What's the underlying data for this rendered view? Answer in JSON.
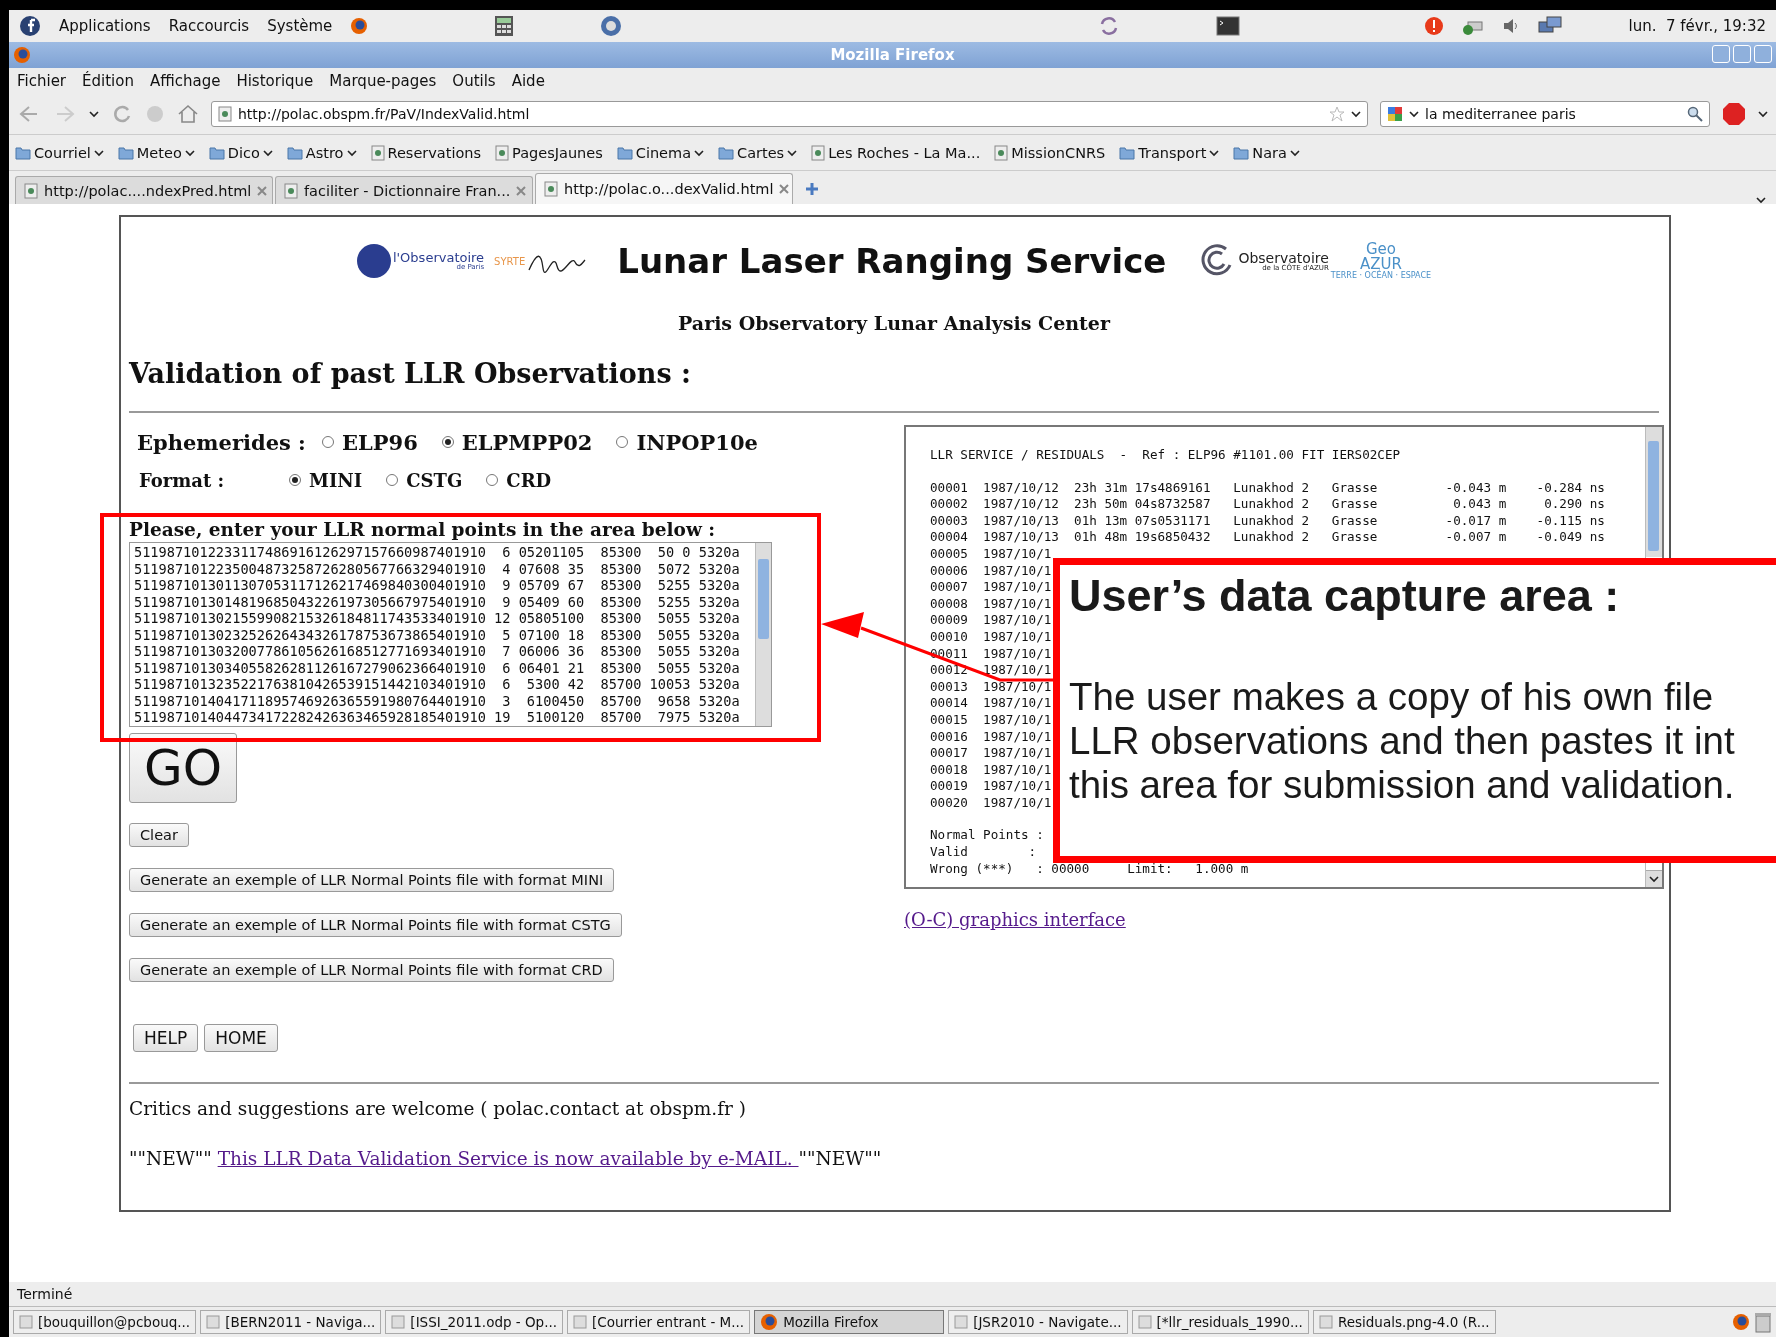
{
  "top_panel": {
    "menus": [
      "Applications",
      "Raccourcis",
      "Système"
    ],
    "clock": "lun.  7 févr., 19:32"
  },
  "window": {
    "title": "Mozilla Firefox"
  },
  "menu_bar": [
    "Fichier",
    "Édition",
    "Affichage",
    "Historique",
    "Marque-pages",
    "Outils",
    "Aide"
  ],
  "address_bar": {
    "value": "http://polac.obspm.fr/PaV/IndexValid.html"
  },
  "search_bar": {
    "value": "la mediterranee paris"
  },
  "bookmarks": [
    {
      "label": "Courriel",
      "kind": "folder"
    },
    {
      "label": "Meteo",
      "kind": "folder"
    },
    {
      "label": "Dico",
      "kind": "folder"
    },
    {
      "label": "Astro",
      "kind": "folder"
    },
    {
      "label": "Reservations",
      "kind": "link"
    },
    {
      "label": "PagesJaunes",
      "kind": "link"
    },
    {
      "label": "Cinema",
      "kind": "folder"
    },
    {
      "label": "Cartes",
      "kind": "folder"
    },
    {
      "label": "Les Roches - La Ma...",
      "kind": "link"
    },
    {
      "label": "MissionCNRS",
      "kind": "link"
    },
    {
      "label": "Transport",
      "kind": "folder"
    },
    {
      "label": "Nara",
      "kind": "folder"
    }
  ],
  "tabs": [
    {
      "label": "http://polac....ndexPred.html",
      "selected": false
    },
    {
      "label": "faciliter - Dictionnaire Fran...",
      "selected": false
    },
    {
      "label": "http://polac.o...dexValid.html",
      "selected": true
    }
  ],
  "page": {
    "logos": {
      "paris": "l'Observatoire",
      "paris_sub": "de Paris",
      "syrte": "SYRTE",
      "oca": "Observatoire",
      "oca_sub": "de la CÔTE d'AZUR",
      "geo": "Geo",
      "azur": "AZUR",
      "tagline": "TERRE · OCÉAN · ESPACE"
    },
    "title": "Lunar Laser Ranging Service",
    "subtitle": "Paris Observatory Lunar Analysis Center",
    "heading": "Validation of past LLR Observations :",
    "ephemerides": {
      "label": "Ephemerides :",
      "options": [
        {
          "label": "ELP96",
          "selected": false
        },
        {
          "label": "ELPMPP02",
          "selected": true
        },
        {
          "label": "INPOP10e",
          "selected": false
        }
      ]
    },
    "format": {
      "label": "Format :",
      "options": [
        {
          "label": "MINI",
          "selected": true
        },
        {
          "label": "CSTG",
          "selected": false
        },
        {
          "label": "CRD",
          "selected": false
        }
      ]
    },
    "input_label": "Please, enter your LLR normal points in the area below :",
    "input_lines": [
      "5119871012233117486916126297157660987401910  6 05201105  85300  50 0 5320a",
      "5119871012235004873258726280567766329401910  4 07608 35  85300  5072 5320a",
      "5119871013011307053117126217469840300401910  9 05709 67  85300  5255 5320a",
      "5119871013014819685043226197305667975401910  9 05409 60  85300  5255 5320a",
      "5119871013021559908215326184811743533401910 12 05805100  85300  5055 5320a",
      "5119871013023252626434326178753673865401910  5 07100 18  85300  5055 5320a",
      "5119871013032007786105626168512771693401910  7 06006 36  85300  5055 5320a",
      "5119871013034055826281126167279062366401910  6 06401 21  85300  5055 5320a",
      "5119871013235221763810426539151442103401910  6  5300 42  85700 10053 5320a",
      "5119871014041711895746926365591980764401910  3  6100450  85700  9658 5320a",
      "5119871014044734172282426363465928185401910 19  5100120  85700  7975 5320a"
    ],
    "go_button": "GO",
    "clear_button": "Clear",
    "example_buttons": [
      "Generate an exemple of LLR Normal Points file with format MINI",
      "Generate an exemple of LLR Normal Points file with format CSTG",
      "Generate an exemple of LLR Normal Points file with format CRD"
    ],
    "nav_buttons": [
      "HELP",
      "HOME"
    ],
    "residuals": {
      "header": "LLR SERVICE / RESIDUALS  -  Ref : ELP96 #1101.00 FIT IERS02CEP",
      "rows": [
        "00001  1987/10/12  23h 31m 17s4869161   Lunakhod 2   Grasse         -0.043 m    -0.284 ns",
        "00002  1987/10/12  23h 50m 04s8732587   Lunakhod 2   Grasse          0.043 m     0.290 ns",
        "00003  1987/10/13  01h 13m 07s0531171   Lunakhod 2   Grasse         -0.017 m    -0.115 ns",
        "00004  1987/10/13  01h 48m 19s6850432   Lunakhod 2   Grasse         -0.007 m    -0.049 ns",
        "00005  1987/10/1",
        "00006  1987/10/1",
        "00007  1987/10/1",
        "00008  1987/10/1",
        "00009  1987/10/1",
        "00010  1987/10/1",
        "00011  1987/10/1",
        "00012  1987/10/1",
        "00013  1987/10/1",
        "00014  1987/10/1",
        "00015  1987/10/1",
        "00016  1987/10/1",
        "00017  1987/10/1",
        "00018  1987/10/1",
        "00019  1987/10/1",
        "00020  1987/10/1"
      ],
      "summary": [
        "Normal Points :",
        "Valid        :",
        "Wrong (***)   : 00000     Limit:   1.000 m"
      ]
    },
    "graphics_link": "(O-C) graphics interface",
    "contact": "Critics and suggestions are welcome ( polac.contact at obspm.fr )",
    "email_notice": {
      "before": "\"\"NEW\"\" ",
      "link": "This LLR Data Validation Service is now available by e-MAIL. ",
      "after": "\"\"NEW\"\""
    }
  },
  "callout": {
    "title": "User’s data capture area :",
    "lines": [
      "The user makes a copy of his own file",
      "LLR observations and then pastes it int",
      "this area for submission and validation."
    ]
  },
  "status_bar": "Terminé",
  "taskbar": [
    {
      "label": "[bouquillon@pcbouq...",
      "selected": false
    },
    {
      "label": "[BERN2011 - Naviga...",
      "selected": false
    },
    {
      "label": "[ISSI_2011.odp - Op...",
      "selected": false
    },
    {
      "label": "[Courrier entrant - M...",
      "selected": false
    },
    {
      "label": "Mozilla Firefox",
      "selected": true
    },
    {
      "label": "[JSR2010 - Navigate...",
      "selected": false
    },
    {
      "label": "[*llr_residuals_1990...",
      "selected": false
    },
    {
      "label": "Residuals.png-4.0 (R...",
      "selected": false
    }
  ]
}
